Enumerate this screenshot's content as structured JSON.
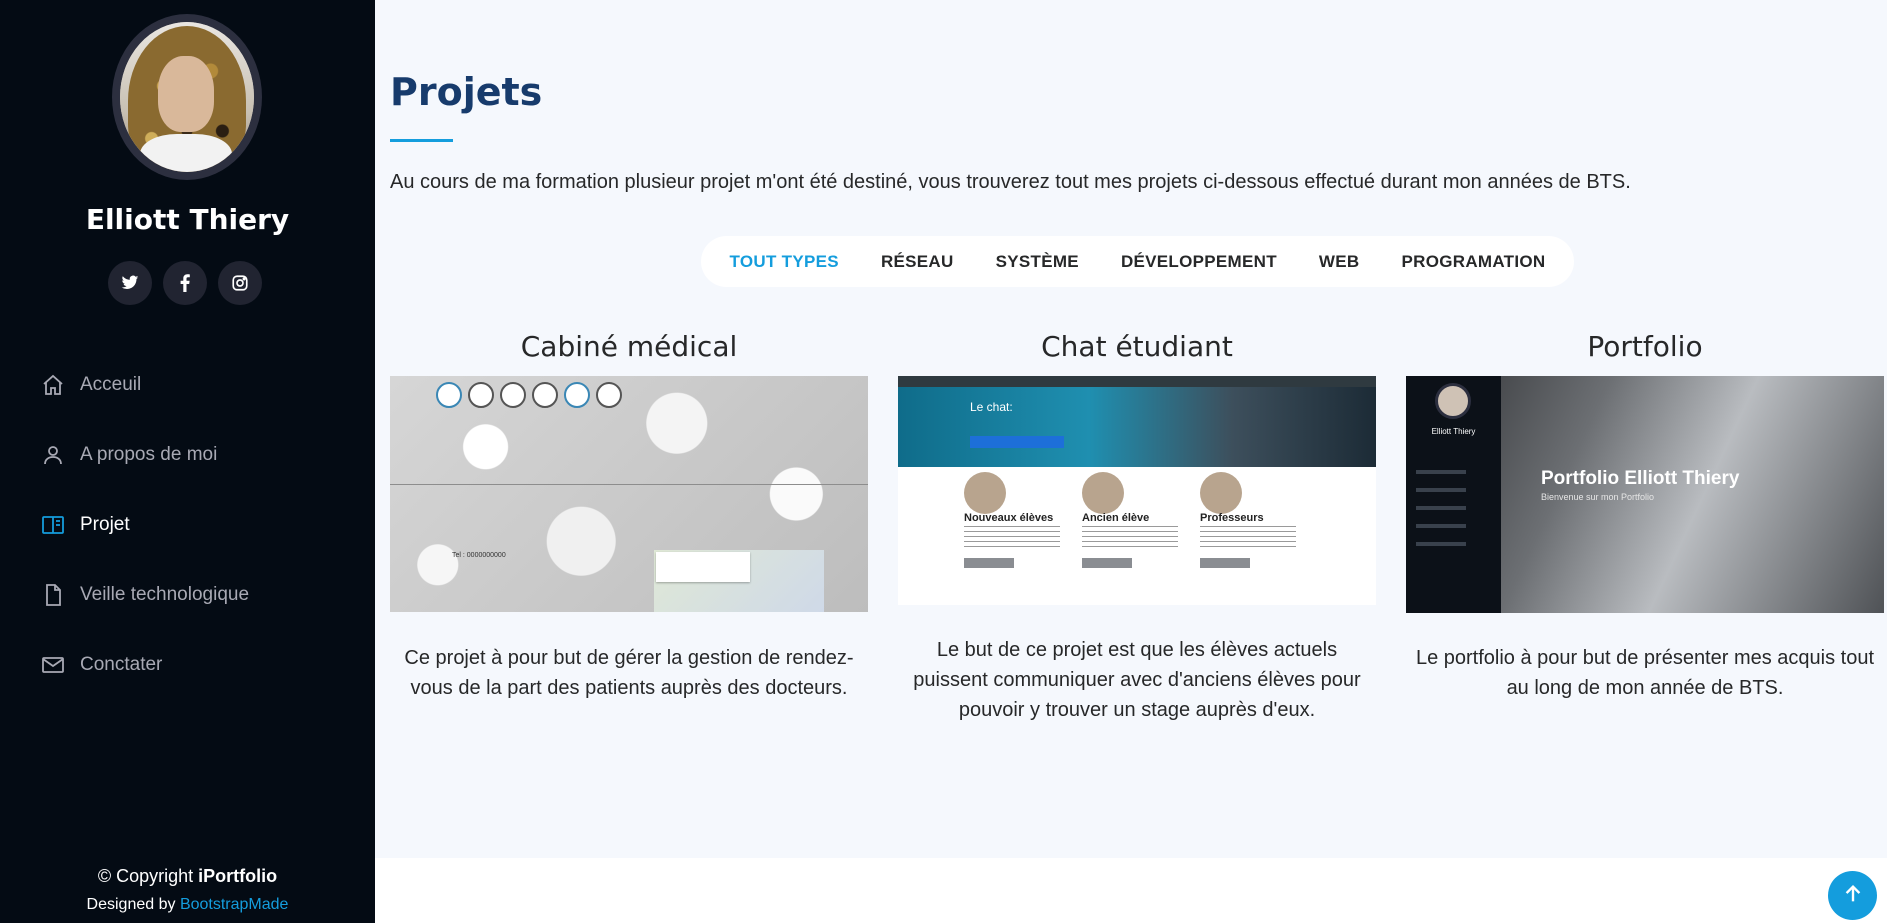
{
  "sidebar": {
    "profile_name": "Elliott Thiery",
    "social": [
      {
        "icon": "twitter-icon",
        "glyph": "𝕥"
      },
      {
        "icon": "facebook-icon",
        "glyph": "f"
      },
      {
        "icon": "instagram-icon",
        "glyph": "◎"
      }
    ],
    "nav": [
      {
        "label": "Acceuil",
        "icon": "home-icon",
        "active": false
      },
      {
        "label": "A propos de moi",
        "icon": "person-icon",
        "active": false
      },
      {
        "label": "Projet",
        "icon": "book-icon",
        "active": true
      },
      {
        "label": "Veille technologique",
        "icon": "file-icon",
        "active": false
      },
      {
        "label": "Conctater",
        "icon": "envelope-icon",
        "active": false
      }
    ],
    "footer": {
      "copyright_prefix": "© Copyright ",
      "copyright_brand": "iPortfolio",
      "designed_prefix": "Designed by ",
      "designed_link": "BootstrapMade"
    }
  },
  "main": {
    "title": "Projets",
    "intro": "Au cours de ma formation plusieur projet m'ont été destiné, vous trouverez tout mes projets ci-dessous effectué durant mon années de BTS.",
    "filters": [
      "TOUT TYPES",
      "RÉSEAU",
      "SYSTÈME",
      "DÉVELOPPEMENT",
      "WEB",
      "PROGRAMATION"
    ],
    "active_filter": "TOUT TYPES",
    "projects": [
      {
        "title": "Cabiné médical",
        "description": "Ce projet à pour but de gérer la gestion de rendez-vous de la part des patients auprès des docteurs."
      },
      {
        "title": "Chat étudiant",
        "description": "Le but de ce projet est que les élèves actuels puissent communiquer avec d'anciens élèves pour pouvoir y trouver un stage auprès d'eux.",
        "thumb": {
          "header_label": "Le chat:",
          "columns": [
            "Nouveaux élèves",
            "Ancien élève",
            "Professeurs"
          ]
        }
      },
      {
        "title": "Portfolio",
        "description": "Le portfolio à pour but de présenter mes acquis tout au long de mon année de BTS.",
        "thumb": {
          "side_name": "Elliott Thiery",
          "headline": "Portfolio Elliott Thiery",
          "subline": "Bienvenue sur mon Portfolio"
        }
      }
    ]
  },
  "colors": {
    "accent": "#149ddd",
    "sidebar_bg": "#040b14",
    "title": "#173b6c"
  }
}
